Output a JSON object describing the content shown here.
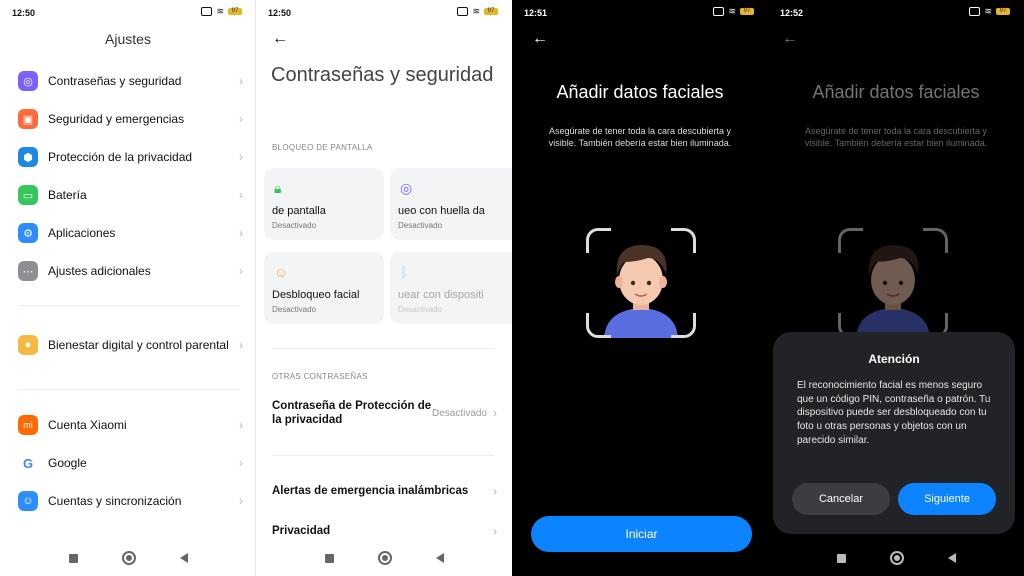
{
  "panel1": {
    "status_time": "12:50",
    "battery": "97",
    "title": "Ajustes",
    "items": [
      {
        "label": "Contraseñas y seguridad",
        "icon": "fingerprint-icon",
        "color": "#7b61ff"
      },
      {
        "label": "Seguridad y emergencias",
        "icon": "shield-icon",
        "color": "#ff6a3d"
      },
      {
        "label": "Protección de la privacidad",
        "icon": "privacy-icon",
        "color": "#1e88e5"
      },
      {
        "label": "Batería",
        "icon": "battery-icon",
        "color": "#34c759"
      },
      {
        "label": "Aplicaciones",
        "icon": "gear-icon",
        "color": "#2e8cff"
      },
      {
        "label": "Ajustes adicionales",
        "icon": "more-icon",
        "color": "#8e8e93"
      },
      {
        "label": "Bienestar digital y control parental",
        "icon": "wellbeing-icon",
        "color": "#f5b942"
      },
      {
        "label": "Cuenta Xiaomi",
        "icon": "xiaomi-icon",
        "color": "#ff6900"
      },
      {
        "label": "Google",
        "icon": "google-icon",
        "color": "#ffffff"
      },
      {
        "label": "Cuentas y sincronización",
        "icon": "account-icon",
        "color": "#2e8cff"
      }
    ]
  },
  "panel2": {
    "status_time": "12:50",
    "battery": "97",
    "title": "Contraseñas y seguridad",
    "section_lock": "BLOQUEO DE PANTALLA",
    "cards": [
      {
        "title": "de pantalla",
        "sub": "Desactivado",
        "icon": "lock-icon"
      },
      {
        "title": "ueo con huella da",
        "sub": "Desactivado",
        "icon": "fingerprint-icon"
      },
      {
        "title": "Desbloqueo facial",
        "sub": "Desactivado",
        "icon": "face-icon"
      },
      {
        "title": "uear con dispositi",
        "sub": "Desactivado",
        "icon": "bluetooth-icon"
      }
    ],
    "section_other": "OTRAS CONTRASEÑAS",
    "rows": [
      {
        "label": "Contraseña de Protección de la privacidad",
        "value": "Desactivado"
      },
      {
        "label": "Alertas de emergencia inalámbricas",
        "value": ""
      },
      {
        "label": "Privacidad",
        "value": ""
      }
    ]
  },
  "panel3": {
    "status_time": "12:51",
    "battery": "97",
    "title": "Añadir datos faciales",
    "desc": "Asegúrate de tener toda la cara descubierta y visible. También debería estar bien iluminada.",
    "button": "Iniciar"
  },
  "panel4": {
    "status_time": "12:52",
    "battery": "97",
    "title": "Añadir datos faciales",
    "desc": "Asegúrate de tener toda la cara descubierta y visible. También debería estar bien iluminada.",
    "dialog": {
      "title": "Atención",
      "body": "El reconocimiento facial es menos seguro que un código PIN, contraseña o patrón. Tu dispositivo puede ser desbloqueado con tu foto u otras personas y objetos con un parecido similar.",
      "cancel": "Cancelar",
      "next": "Siguiente"
    }
  },
  "colors": {
    "accent": "#0d84ff",
    "dark_bg": "#000000",
    "dialog_bg": "#222326"
  }
}
